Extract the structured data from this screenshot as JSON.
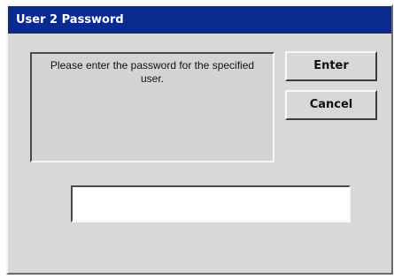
{
  "dialog": {
    "title": "User 2 Password",
    "message": "Please enter the password for the specified user.",
    "buttons": {
      "enter_label": "Enter",
      "cancel_label": "Cancel"
    },
    "password_field": {
      "value": "",
      "placeholder": ""
    }
  },
  "colors": {
    "titlebar": "#0b2a8f",
    "window_face": "#d8d8d8",
    "input_background": "#ffffff"
  }
}
